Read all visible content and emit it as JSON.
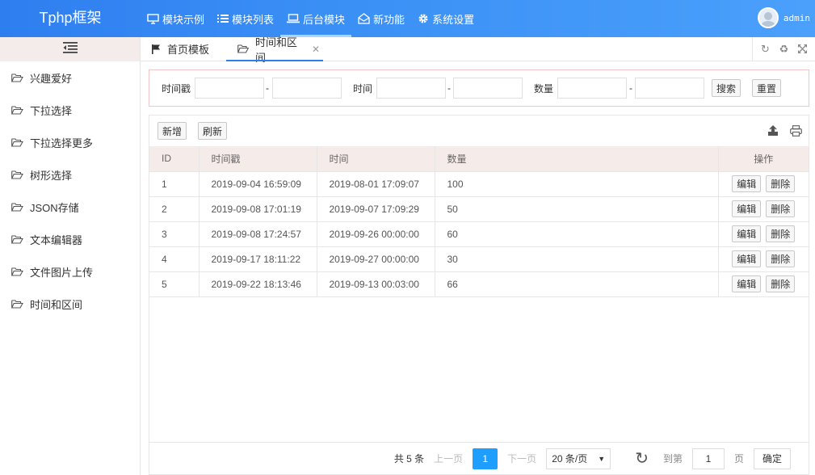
{
  "header": {
    "brand": "Tphp框架",
    "nav": [
      {
        "label": "模块示例",
        "icon": "monitor-icon"
      },
      {
        "label": "模块列表",
        "icon": "list-icon"
      },
      {
        "label": "后台模块",
        "icon": "laptop-icon",
        "active": true
      },
      {
        "label": "新功能",
        "icon": "envelope-open-icon"
      },
      {
        "label": "系统设置",
        "icon": "gear-icon"
      }
    ],
    "user": "admin"
  },
  "sidebar": {
    "items": [
      {
        "label": "兴趣爱好"
      },
      {
        "label": "下拉选择"
      },
      {
        "label": "下拉选择更多"
      },
      {
        "label": "树形选择"
      },
      {
        "label": "JSON存储"
      },
      {
        "label": "文本编辑器"
      },
      {
        "label": "文件图片上传"
      },
      {
        "label": "时间和区间"
      }
    ]
  },
  "tabs": [
    {
      "label": "首页模板",
      "icon": "flag-icon"
    },
    {
      "label": "时间和区间",
      "icon": "folder-open-icon",
      "active": true,
      "closable": true
    }
  ],
  "search": {
    "timestamp_label": "时间戳",
    "time_label": "时间",
    "quantity_label": "数量",
    "dash": "-",
    "search_button": "搜索",
    "reset_button": "重置"
  },
  "toolbar": {
    "add_button": "新增",
    "refresh_button": "刷新"
  },
  "table": {
    "columns": [
      "ID",
      "时间戳",
      "时间",
      "数量",
      "操作"
    ],
    "edit_label": "编辑",
    "delete_label": "删除",
    "rows": [
      {
        "id": "1",
        "timestamp": "2019-09-04 16:59:09",
        "time": "2019-08-01 17:09:07",
        "quantity": "100"
      },
      {
        "id": "2",
        "timestamp": "2019-09-08 17:01:19",
        "time": "2019-09-07 17:09:29",
        "quantity": "50"
      },
      {
        "id": "3",
        "timestamp": "2019-09-08 17:24:57",
        "time": "2019-09-26 00:00:00",
        "quantity": "60"
      },
      {
        "id": "4",
        "timestamp": "2019-09-17 18:11:22",
        "time": "2019-09-27 00:00:00",
        "quantity": "30"
      },
      {
        "id": "5",
        "timestamp": "2019-09-22 18:13:46",
        "time": "2019-09-13 00:03:00",
        "quantity": "66"
      }
    ]
  },
  "pagination": {
    "total": "共 5 条",
    "prev": "上一页",
    "current": "1",
    "next": "下一页",
    "page_size": "20 条/页",
    "goto_label": "到第",
    "goto_value": "1",
    "page_unit": "页",
    "confirm": "确定"
  },
  "colors": {
    "header_blue": "#2f7ef0",
    "accent": "#1e9fff",
    "table_header_bg": "#f5ebe8",
    "search_border": "#f2c6c6"
  }
}
